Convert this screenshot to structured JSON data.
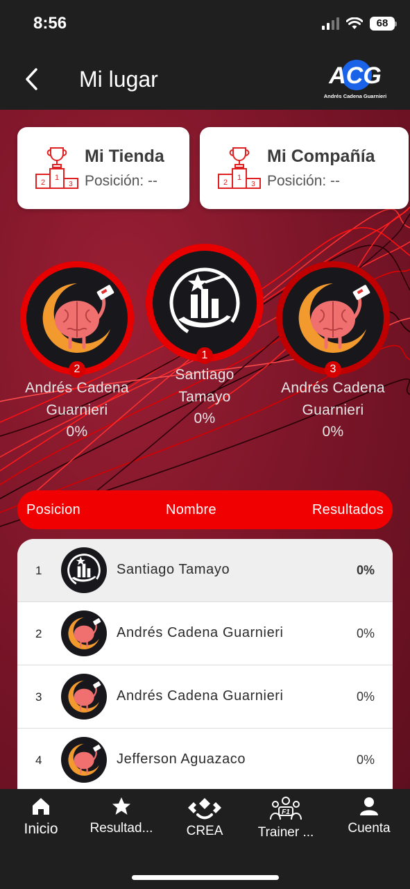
{
  "status_bar": {
    "time": "8:56",
    "battery": "68"
  },
  "header": {
    "title": "Mi lugar",
    "logo_text": "Andrés Cadena Guarnieri"
  },
  "cards": [
    {
      "title": "Mi Tienda",
      "subtitle": "Posición: --"
    },
    {
      "title": "Mi Compañía",
      "subtitle": "Posición: --"
    }
  ],
  "podium": [
    {
      "rank": "2",
      "name": "Andrés Cadena Guarnieri",
      "result": "0%",
      "avatar": "brain-icon"
    },
    {
      "rank": "1",
      "name": "Santiago Tamayo",
      "result": "0%",
      "avatar": "trophy-logo-icon"
    },
    {
      "rank": "3",
      "name": "Andrés Cadena Guarnieri",
      "result": "0%",
      "avatar": "brain-icon"
    }
  ],
  "table": {
    "headers": {
      "position": "Posicion",
      "name": "Nombre",
      "results": "Resultados"
    },
    "rows": [
      {
        "position": "1",
        "name": "Santiago Tamayo",
        "result": "0%",
        "avatar": "trophy-logo-icon"
      },
      {
        "position": "2",
        "name": "Andrés Cadena Guarnieri",
        "result": "0%",
        "avatar": "brain-icon"
      },
      {
        "position": "3",
        "name": "Andrés Cadena Guarnieri",
        "result": "0%",
        "avatar": "brain-icon"
      },
      {
        "position": "4",
        "name": "Jefferson Aguazaco",
        "result": "0%",
        "avatar": "brain-icon"
      }
    ]
  },
  "bottom_nav": [
    {
      "label": "Inicio",
      "icon": "home-icon"
    },
    {
      "label": "Resultad...",
      "icon": "star-icon"
    },
    {
      "label": "CREA",
      "icon": "crea-icon"
    },
    {
      "label": "Trainer ...",
      "icon": "trainer-f1-icon"
    },
    {
      "label": "Cuenta",
      "icon": "user-icon"
    }
  ],
  "colors": {
    "accent_red": "#f00000",
    "background_dark": "#1f1f1f",
    "background_maroon": "#7e1629"
  }
}
